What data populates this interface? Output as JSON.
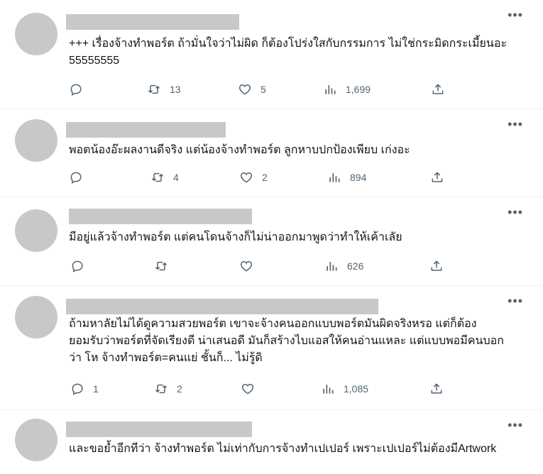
{
  "posts": [
    {
      "text": "+++ เรื่องจ้างทำพอร์ต ถ้ามั่นใจว่าไม่ผิด ก็ต้องโปร่งใสกับกรรมการ ไม่ใช่กระมิดกระเมี้ยนอะ 55555555",
      "replies": "",
      "reposts": "13",
      "likes": "5",
      "views": "1,699"
    },
    {
      "text": "พอตน้องอ๊ะผลงานดีจริง แต่น้องจ้างทำพอร์ต ลูกหาบปกป้องเพียบ เก่งอะ",
      "replies": "",
      "reposts": "4",
      "likes": "2",
      "views": "894"
    },
    {
      "text": "มีอยู่แล้วจ้างทำพอร์ต แต่คนโดนจ้างก็ไม่น่าออกมาพูดว่าทำให้เค้าเลัย",
      "replies": "",
      "reposts": "",
      "likes": "",
      "views": "626"
    },
    {
      "text": "ถ้ามหาลัยไม่ได้ดูความสวยพอร์ต เขาจะจ้างคนออกแบบพอร์ตมันผิดจริงหรอ แต่ก็ต้องยอมรับว่าพอร์ตที่จัดเรียงดี น่าเสนอดี มันก็สร้างไบแอสให้คนอ่านแหละ แต่แบบพอมีคนบอกว่า โห จ้างทำพอร์ต=คนแย่ ชั้นก็... ไม่รู้ดิ",
      "replies": "1",
      "reposts": "2",
      "likes": "",
      "views": "1,085"
    },
    {
      "text": "และขอย้ำอีกทีว่า จ้างทำพอร์ต ไม่เท่ากับการจ้างทำเปเปอร์ เพราะเปเปอร์ไม่ต้องมีArtwork",
      "replies": "",
      "reposts": "",
      "likes": "",
      "views": ""
    }
  ],
  "icons": {
    "reply": "reply-icon",
    "repost": "repost-icon",
    "like": "heart-icon",
    "views": "views-icon",
    "share": "share-icon",
    "more": "more-icon"
  },
  "colors": {
    "icon": "#536471",
    "text": "#0f1419",
    "placeholder": "#c8c8c8",
    "divider": "#eff3f4"
  }
}
